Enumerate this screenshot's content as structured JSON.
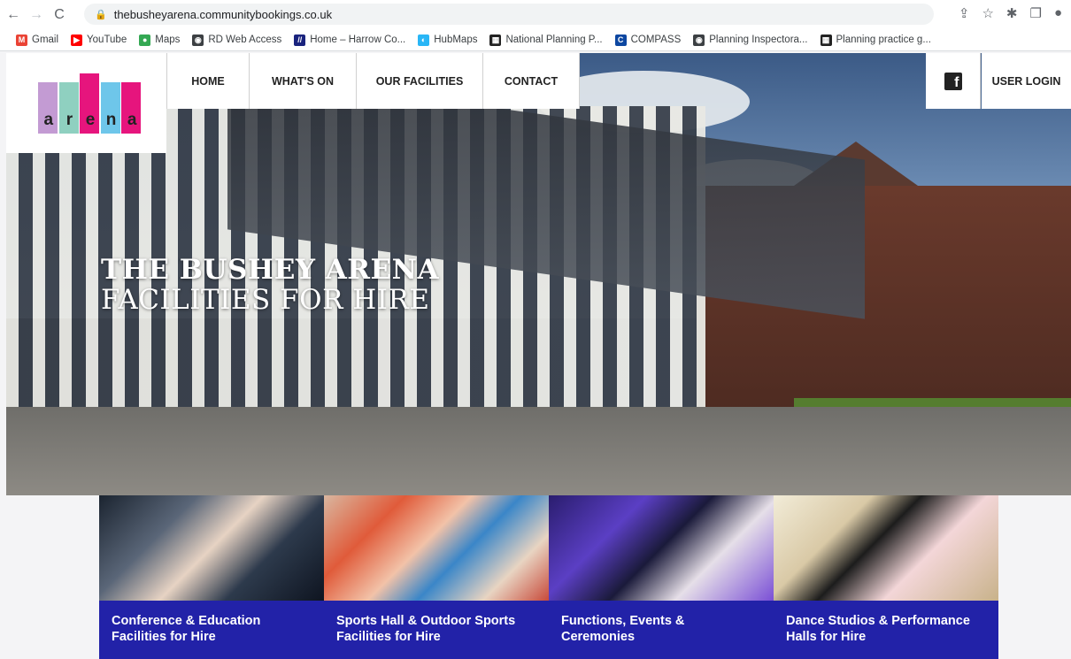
{
  "browser": {
    "url": "thebusheyarena.communitybookings.co.uk",
    "nav": {
      "back": "←",
      "forward": "→",
      "reload": "C"
    },
    "right_icons": {
      "share": "⇪",
      "star": "☆",
      "extensions": "✱",
      "split": "❐",
      "profile": "●"
    }
  },
  "bookmarks": [
    {
      "label": "Gmail",
      "icon": "gmail-icon",
      "icon_text": "M",
      "color": "#ea4335"
    },
    {
      "label": "YouTube",
      "icon": "youtube-icon",
      "icon_text": "▶",
      "color": "#ff0000"
    },
    {
      "label": "Maps",
      "icon": "maps-icon",
      "icon_text": "●",
      "color": "#34a853"
    },
    {
      "label": "RD Web Access",
      "icon": "globe-icon",
      "icon_text": "◉",
      "color": "#3c4043"
    },
    {
      "label": "Home – Harrow Co...",
      "icon": "harrow-icon",
      "icon_text": "//",
      "color": "#1a237e"
    },
    {
      "label": "HubMaps",
      "icon": "hubmaps-icon",
      "icon_text": "◐",
      "color": "#29b6f6"
    },
    {
      "label": "National Planning P...",
      "icon": "gov-icon",
      "icon_text": "▦",
      "color": "#222222"
    },
    {
      "label": "COMPASS",
      "icon": "compass-icon",
      "icon_text": "C",
      "color": "#0d47a1"
    },
    {
      "label": "Planning Inspectora...",
      "icon": "globe-icon",
      "icon_text": "◉",
      "color": "#3c4043"
    },
    {
      "label": "Planning practice g...",
      "icon": "gov-icon",
      "icon_text": "▦",
      "color": "#222222"
    }
  ],
  "logo": {
    "letters": [
      "a",
      "r",
      "e",
      "n",
      "a"
    ],
    "colors": [
      "#c39bd3",
      "#8fd0c0",
      "#e6157d",
      "#6ec6ea",
      "#e6157d"
    ]
  },
  "nav": {
    "items": [
      "HOME",
      "WHAT'S ON",
      "OUR FACILITIES",
      "CONTACT"
    ],
    "facebook": "f",
    "login": "USER LOGIN"
  },
  "hero": {
    "title_line1": "THE BUSHEY ARENA",
    "title_line2": "FACILITIES FOR HIRE"
  },
  "cards": [
    {
      "line1": "Conference & Education",
      "line2": "Facilities for Hire"
    },
    {
      "line1": "Sports Hall & Outdoor Sports",
      "line2": "Facilities for Hire"
    },
    {
      "line1": "Functions, Events &",
      "line2": "Ceremonies"
    },
    {
      "line1": "Dance Studios & Performance",
      "line2": "Halls for Hire"
    }
  ]
}
